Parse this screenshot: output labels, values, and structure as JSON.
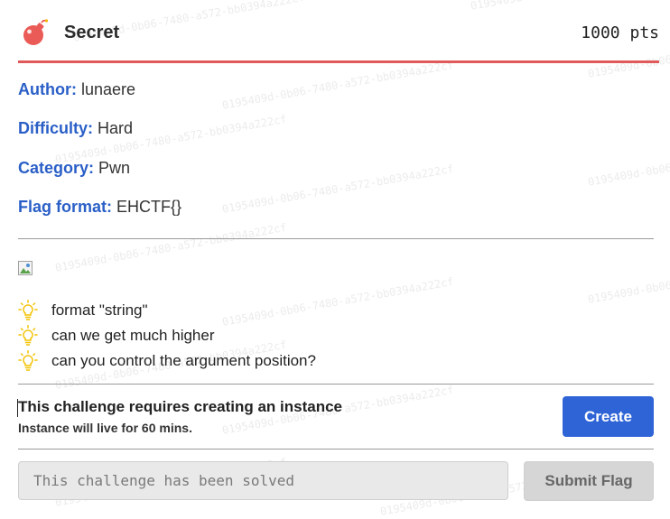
{
  "challenge": {
    "title": "Secret",
    "points": "1000 pts",
    "meta": [
      {
        "key": "Author:",
        "value": "lunaere"
      },
      {
        "key": "Difficulty:",
        "value": "Hard"
      },
      {
        "key": "Category:",
        "value": "Pwn"
      },
      {
        "key": "Flag format:",
        "value": "EHCTF{}"
      }
    ],
    "hints": [
      "format \"string\"",
      "can we get much higher",
      "can you control the argument position?"
    ]
  },
  "instance": {
    "title": "This challenge requires creating an instance",
    "subtitle": "Instance will live for 60 mins.",
    "create_label": "Create"
  },
  "flag": {
    "placeholder": "This challenge has been solved",
    "submit_label": "Submit Flag"
  },
  "watermark": "0195409d-0b06-7480-a572-bb0394a222cf",
  "colors": {
    "accent": "#2f64d6",
    "label": "#2a5fc7",
    "header_rule": "#e05a5a",
    "bomb": "#ea5a56",
    "hint_bulb": "#f2c200"
  },
  "icons": {
    "title": "bomb-icon",
    "hint": "lightbulb-icon",
    "image": "broken-image-icon"
  }
}
